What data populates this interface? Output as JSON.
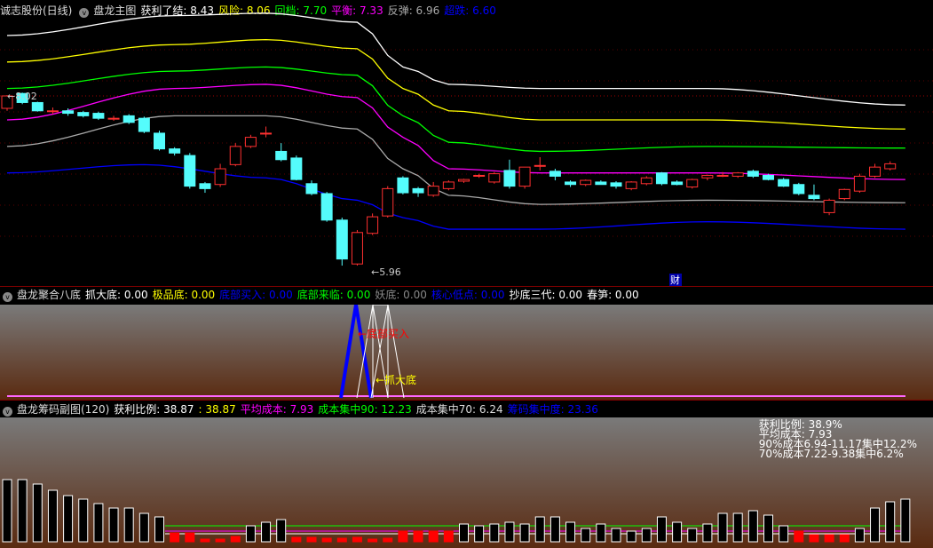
{
  "main": {
    "stock": "诚志股份(日线)",
    "indicator": "盘龙主图",
    "items": [
      {
        "label": "获利了结: 8.43",
        "color": "#ffffff"
      },
      {
        "label": "风险: 8.06",
        "color": "#ffff00"
      },
      {
        "label": "回档: 7.70",
        "color": "#00ff00"
      },
      {
        "label": "平衡: 7.33",
        "color": "#ff00ff"
      },
      {
        "label": "反弹: 6.96",
        "color": "#aaaaaa"
      },
      {
        "label": "超跌: 6.60",
        "color": "#0000ff"
      }
    ],
    "high_label": "8.02",
    "low_label": "←5.96",
    "cai_label": "财"
  },
  "sub1": {
    "indicator": "盘龙聚合八底",
    "items": [
      {
        "label": "抓大底: 0.00",
        "color": "#ffffff"
      },
      {
        "label": "极品底: 0.00",
        "color": "#ffff00"
      },
      {
        "label": "底部买入: 0.00",
        "color": "#0000ff"
      },
      {
        "label": "底部来临: 0.00",
        "color": "#00ff00"
      },
      {
        "label": "妖底: 0.00",
        "color": "#888888"
      },
      {
        "label": "核心低点: 0.00",
        "color": "#0000ff"
      },
      {
        "label": "抄底三代: 0.00",
        "color": "#ffffff"
      },
      {
        "label": "春笋: 0.00",
        "color": "#ffffff"
      }
    ],
    "ann_buy": "←底部买入",
    "ann_grab": "←抓大底"
  },
  "sub2": {
    "indicator": "盘龙筹码副图(120)",
    "items": [
      {
        "label": "获利比例: 38.87",
        "color": "#ffffff"
      },
      {
        "label": ": 38.87",
        "color": "#ffff00"
      },
      {
        "label": "平均成本: 7.93",
        "color": "#ff00ff"
      },
      {
        "label": "成本集中90: 12.23",
        "color": "#00ff00"
      },
      {
        "label": "成本集中70: 6.24",
        "color": "#dddddd"
      },
      {
        "label": "筹码集中度: 23.36",
        "color": "#0000ff"
      }
    ],
    "info": [
      "获利比例: 38.9%",
      "平均成本: 7.93",
      "90%成本6.94-11.17集中12.2%",
      "70%成本7.22-9.38集中6.2%"
    ],
    "bars": [
      70,
      70,
      65,
      58,
      52,
      48,
      43,
      38,
      38,
      32,
      28,
      -10,
      -10,
      -3,
      -3,
      -6,
      18,
      22,
      25,
      -5,
      -5,
      -4,
      -4,
      -5,
      -3,
      -4,
      -12,
      -12,
      -12,
      -12,
      20,
      18,
      20,
      22,
      20,
      28,
      28,
      22,
      15,
      20,
      15,
      12,
      15,
      28,
      22,
      15,
      20,
      32,
      32,
      35,
      30,
      18,
      -12,
      -8,
      -8,
      -8,
      15,
      38,
      45,
      48
    ]
  },
  "chart_data": {
    "type": "candlestick",
    "price_range": [
      5.8,
      9.3
    ],
    "candles": [
      [
        7.87,
        8.03,
        7.84,
        8.02
      ],
      [
        8.05,
        8.06,
        7.92,
        7.94
      ],
      [
        7.94,
        7.95,
        7.83,
        7.84
      ],
      [
        7.84,
        7.88,
        7.8,
        7.84
      ],
      [
        7.84,
        7.87,
        7.78,
        7.81
      ],
      [
        7.82,
        7.84,
        7.76,
        7.78
      ],
      [
        7.81,
        7.83,
        7.73,
        7.75
      ],
      [
        7.75,
        7.78,
        7.72,
        7.75
      ],
      [
        7.78,
        7.8,
        7.68,
        7.7
      ],
      [
        7.75,
        7.77,
        7.57,
        7.59
      ],
      [
        7.57,
        7.6,
        7.36,
        7.38
      ],
      [
        7.38,
        7.4,
        7.3,
        7.33
      ],
      [
        7.3,
        7.33,
        6.9,
        6.93
      ],
      [
        6.96,
        6.98,
        6.85,
        6.9
      ],
      [
        6.95,
        7.2,
        6.92,
        7.14
      ],
      [
        7.19,
        7.45,
        7.17,
        7.41
      ],
      [
        7.41,
        7.55,
        7.39,
        7.52
      ],
      [
        7.57,
        7.65,
        7.52,
        7.57
      ],
      [
        7.35,
        7.45,
        7.23,
        7.25
      ],
      [
        7.27,
        7.3,
        7.0,
        7.01
      ],
      [
        6.96,
        7.0,
        6.82,
        6.84
      ],
      [
        6.84,
        6.86,
        6.5,
        6.52
      ],
      [
        6.52,
        6.55,
        5.97,
        6.05
      ],
      [
        5.99,
        6.4,
        5.97,
        6.37
      ],
      [
        6.36,
        6.6,
        6.34,
        6.56
      ],
      [
        6.57,
        6.93,
        6.55,
        6.9
      ],
      [
        7.03,
        7.05,
        6.83,
        6.85
      ],
      [
        6.9,
        6.92,
        6.8,
        6.85
      ],
      [
        6.82,
        6.98,
        6.8,
        6.93
      ],
      [
        6.9,
        7.0,
        6.88,
        6.98
      ],
      [
        6.99,
        7.02,
        6.97,
        7.01
      ],
      [
        7.05,
        7.08,
        7.03,
        7.06
      ],
      [
        6.98,
        7.1,
        6.96,
        7.08
      ],
      [
        7.12,
        7.25,
        6.9,
        6.93
      ],
      [
        6.93,
        7.16,
        6.9,
        7.16
      ],
      [
        7.18,
        7.28,
        7.12,
        7.18
      ],
      [
        7.11,
        7.14,
        7.0,
        7.05
      ],
      [
        6.98,
        7.0,
        6.92,
        6.95
      ],
      [
        6.95,
        7.01,
        6.93,
        7.0
      ],
      [
        6.98,
        7.0,
        6.95,
        6.95
      ],
      [
        6.97,
        6.99,
        6.9,
        6.93
      ],
      [
        6.9,
        6.99,
        6.88,
        6.98
      ],
      [
        6.96,
        7.05,
        6.94,
        7.03
      ],
      [
        7.09,
        7.1,
        6.94,
        6.96
      ],
      [
        6.98,
        7.0,
        6.94,
        6.95
      ],
      [
        6.92,
        7.02,
        6.9,
        7.01
      ],
      [
        7.03,
        7.07,
        7.0,
        7.06
      ],
      [
        7.06,
        7.1,
        7.04,
        7.06
      ],
      [
        7.05,
        7.1,
        7.03,
        7.09
      ],
      [
        7.11,
        7.13,
        7.03,
        7.05
      ],
      [
        7.06,
        7.08,
        7.0,
        7.01
      ],
      [
        7.01,
        7.03,
        6.92,
        6.93
      ],
      [
        6.95,
        6.97,
        6.82,
        6.84
      ],
      [
        6.82,
        6.95,
        6.76,
        6.78
      ],
      [
        6.61,
        6.78,
        6.58,
        6.76
      ],
      [
        6.78,
        6.9,
        6.76,
        6.89
      ],
      [
        6.87,
        7.08,
        6.85,
        7.05
      ],
      [
        7.05,
        7.2,
        7.03,
        7.16
      ],
      [
        7.14,
        7.23,
        7.12,
        7.2
      ]
    ],
    "bands": [
      {
        "name": "获利了结",
        "color": "#ffffff",
        "anchors": [
          [
            0,
            8.75
          ],
          [
            11,
            8.99
          ],
          [
            17,
            9.02
          ],
          [
            23,
            8.91
          ],
          [
            26,
            8.37
          ],
          [
            29,
            8.16
          ],
          [
            35,
            8.11
          ],
          [
            46,
            8.11
          ],
          [
            59,
            7.91
          ]
        ]
      },
      {
        "name": "风险",
        "color": "#ffff00",
        "anchors": [
          [
            0,
            8.43
          ],
          [
            11,
            8.64
          ],
          [
            17,
            8.7
          ],
          [
            23,
            8.59
          ],
          [
            26,
            8.11
          ],
          [
            29,
            7.84
          ],
          [
            35,
            7.73
          ],
          [
            46,
            7.73
          ],
          [
            59,
            7.62
          ]
        ]
      },
      {
        "name": "回档",
        "color": "#00ff00",
        "anchors": [
          [
            0,
            8.11
          ],
          [
            11,
            8.32
          ],
          [
            17,
            8.37
          ],
          [
            23,
            8.27
          ],
          [
            26,
            7.78
          ],
          [
            29,
            7.46
          ],
          [
            35,
            7.35
          ],
          [
            46,
            7.41
          ],
          [
            59,
            7.39
          ]
        ]
      },
      {
        "name": "平衡",
        "color": "#ff00ff",
        "anchors": [
          [
            0,
            7.73
          ],
          [
            11,
            8.11
          ],
          [
            17,
            8.16
          ],
          [
            23,
            8.0
          ],
          [
            26,
            7.52
          ],
          [
            29,
            7.14
          ],
          [
            35,
            7.09
          ],
          [
            46,
            7.09
          ],
          [
            59,
            7.01
          ]
        ]
      },
      {
        "name": "反弹",
        "color": "#aaaaaa",
        "anchors": [
          [
            0,
            7.41
          ],
          [
            11,
            7.78
          ],
          [
            17,
            7.78
          ],
          [
            23,
            7.62
          ],
          [
            26,
            7.14
          ],
          [
            29,
            6.82
          ],
          [
            35,
            6.71
          ],
          [
            46,
            6.76
          ],
          [
            59,
            6.73
          ]
        ]
      },
      {
        "name": "超跌",
        "color": "#0000ff",
        "anchors": [
          [
            0,
            7.09
          ],
          [
            9,
            7.19
          ],
          [
            17,
            7.03
          ],
          [
            23,
            6.76
          ],
          [
            26,
            6.55
          ],
          [
            29,
            6.41
          ],
          [
            35,
            6.41
          ],
          [
            46,
            6.5
          ],
          [
            59,
            6.41
          ]
        ]
      }
    ]
  }
}
